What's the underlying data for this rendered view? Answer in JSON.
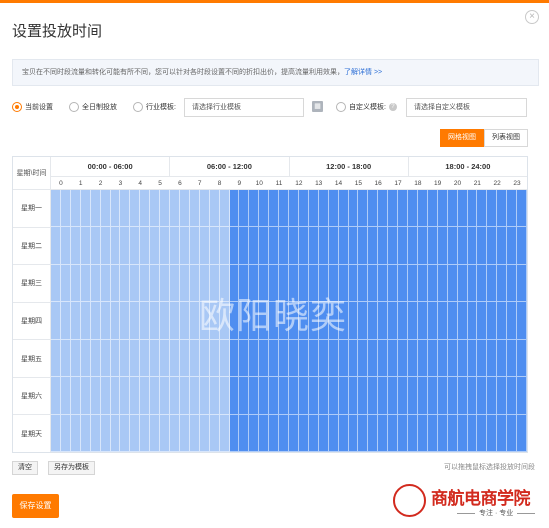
{
  "dialog": {
    "title": "设置投放时间",
    "close_label": "×"
  },
  "notice": {
    "text": "宝贝在不同时段流量和转化可能有所不同，您可以针对各时段设置不同的折扣出价，提高流量利用效果，",
    "link": "了解详情 >>"
  },
  "options": {
    "current": "当前设置",
    "all_day": "全日制投放",
    "industry": "行业模板:",
    "industry_placeholder": "请选择行业模板",
    "custom": "自定义模板:",
    "custom_placeholder": "请选择自定义模板",
    "selected": "current",
    "help_icon_label": "?"
  },
  "view_tabs": {
    "grid": "网格视图",
    "list": "列表视图",
    "active": "grid"
  },
  "grid": {
    "corner_label": "星期\\时间",
    "ranges": [
      "00:00 - 06:00",
      "06:00 - 12:00",
      "12:00 - 18:00",
      "18:00 - 24:00"
    ],
    "hours": [
      "0",
      "1",
      "2",
      "3",
      "4",
      "5",
      "6",
      "7",
      "8",
      "9",
      "10",
      "11",
      "12",
      "13",
      "14",
      "15",
      "16",
      "17",
      "18",
      "19",
      "20",
      "21",
      "22",
      "23"
    ],
    "days": [
      "星期一",
      "星期二",
      "星期三",
      "星期四",
      "星期五",
      "星期六",
      "星期天"
    ],
    "light_until_hour": 9,
    "colors": {
      "light": "#a9c8f5",
      "dark": "#4f8ef0"
    }
  },
  "watermark": "欧阳晓奕",
  "actions": {
    "clear": "清空",
    "save_template": "另存为模板",
    "hint": "可以拖拽鼠标选择投放时间段",
    "save": "保存设置"
  },
  "brand": {
    "name": "商航电商学院",
    "tagline": "专注 · 专业"
  },
  "accent_color": "#ff7a00"
}
